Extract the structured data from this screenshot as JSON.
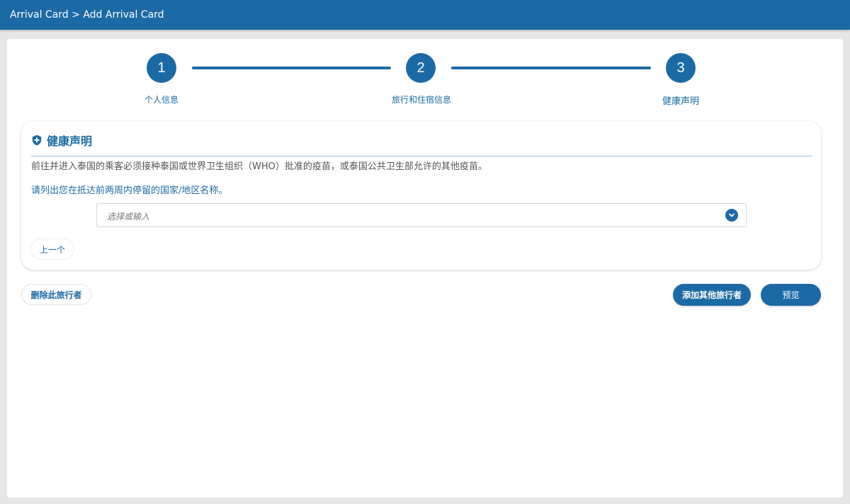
{
  "header": {
    "breadcrumb": "Arrival Card > Add Arrival Card"
  },
  "stepper": {
    "steps": [
      {
        "number": "1",
        "label": "个人信息"
      },
      {
        "number": "2",
        "label": "旅行和住宿信息"
      },
      {
        "number": "3",
        "label": "健康声明"
      }
    ]
  },
  "health": {
    "title": "健康声明",
    "icon": "shield-plus-icon",
    "notice": "前往并进入泰国的乘客必须接种泰国或世界卫生组织（WHO）批准的疫苗，或泰国公共卫生部允许的其他疫苗。",
    "question": "请列出您在抵达前两周内停留的国家/地区名称。",
    "select_placeholder": "选择或输入",
    "prev_button": "上一个"
  },
  "actions": {
    "delete_traveler": "删除此旅行者",
    "add_traveler": "添加其他旅行者",
    "preview": "预览"
  },
  "colors": {
    "primary": "#1c6aa5",
    "background": "#e6e6e6"
  }
}
